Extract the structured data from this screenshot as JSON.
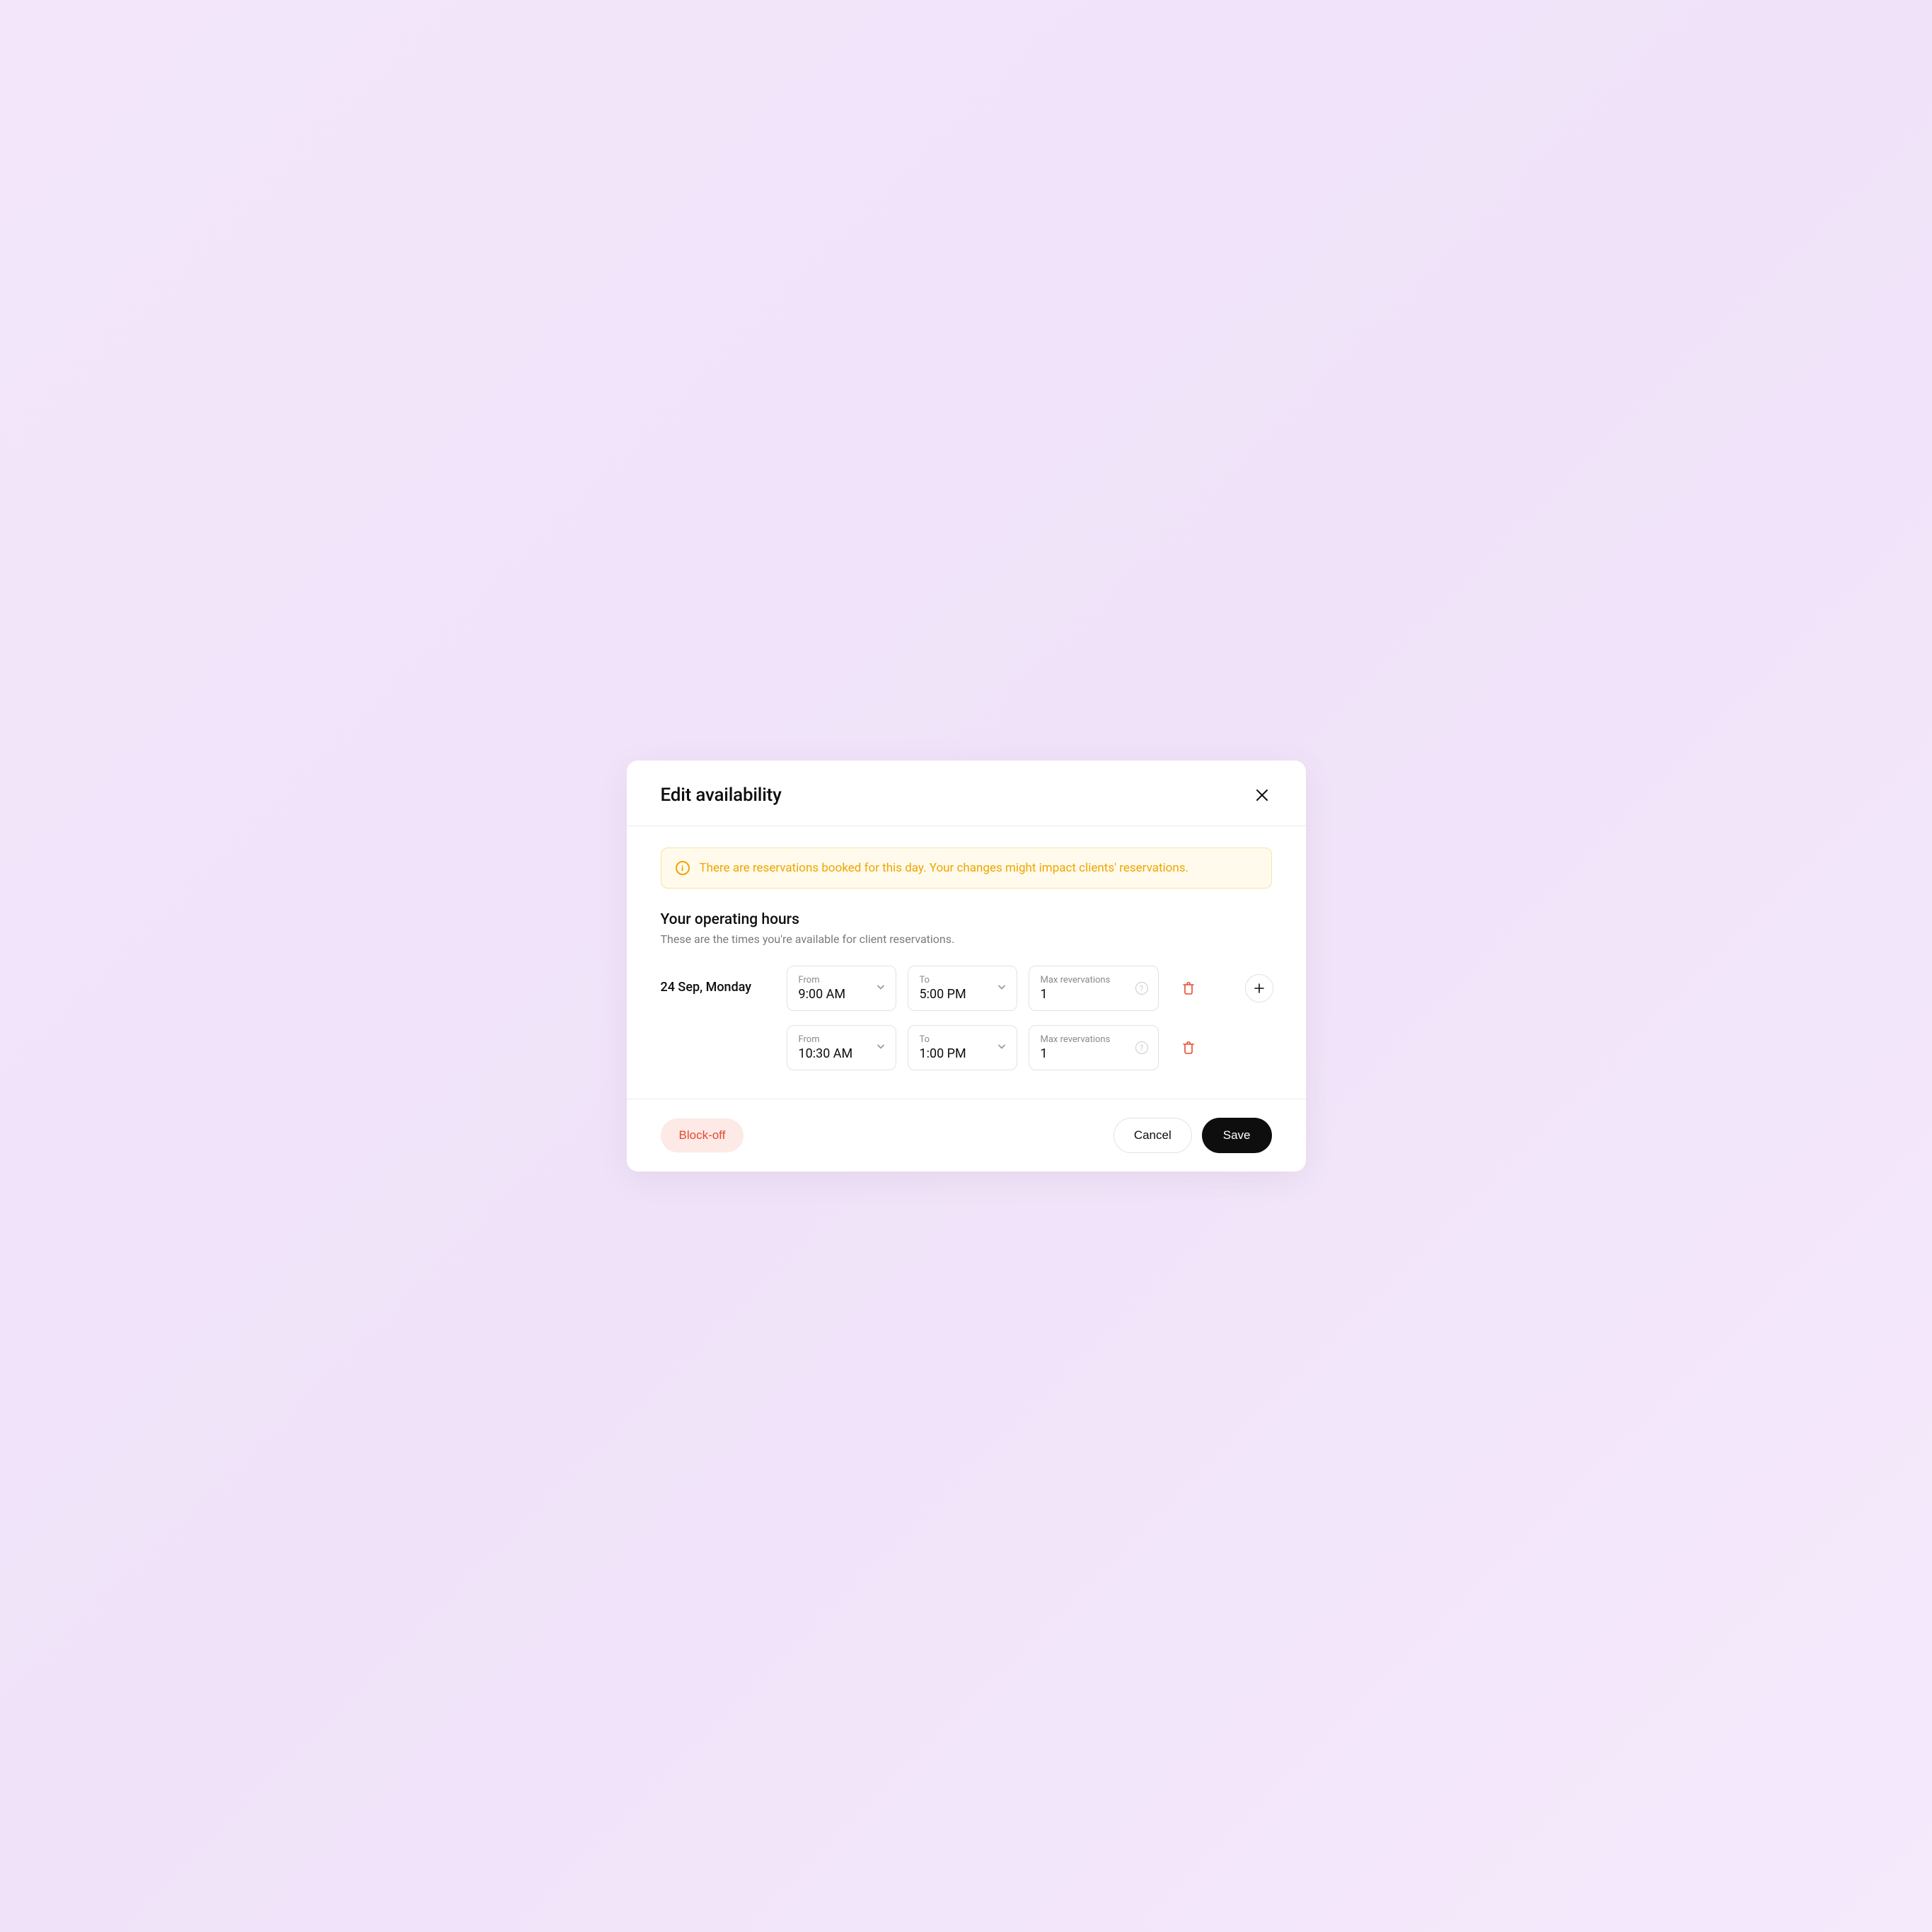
{
  "modal": {
    "title": "Edit availability"
  },
  "warning": {
    "text": "There are reservations booked for this day. Your changes might impact clients' reservations."
  },
  "section": {
    "title": "Your operating hours",
    "subtitle": "These are the times you're available for client reservations."
  },
  "date_label": "24 Sep, Monday",
  "labels": {
    "from": "From",
    "to": "To",
    "max": "Max revervations"
  },
  "rows": [
    {
      "from": "9:00 AM",
      "to": "5:00 PM",
      "max": "1"
    },
    {
      "from": "10:30 AM",
      "to": "1:00 PM",
      "max": "1"
    }
  ],
  "footer": {
    "block_off": "Block-off",
    "cancel": "Cancel",
    "save": "Save"
  }
}
